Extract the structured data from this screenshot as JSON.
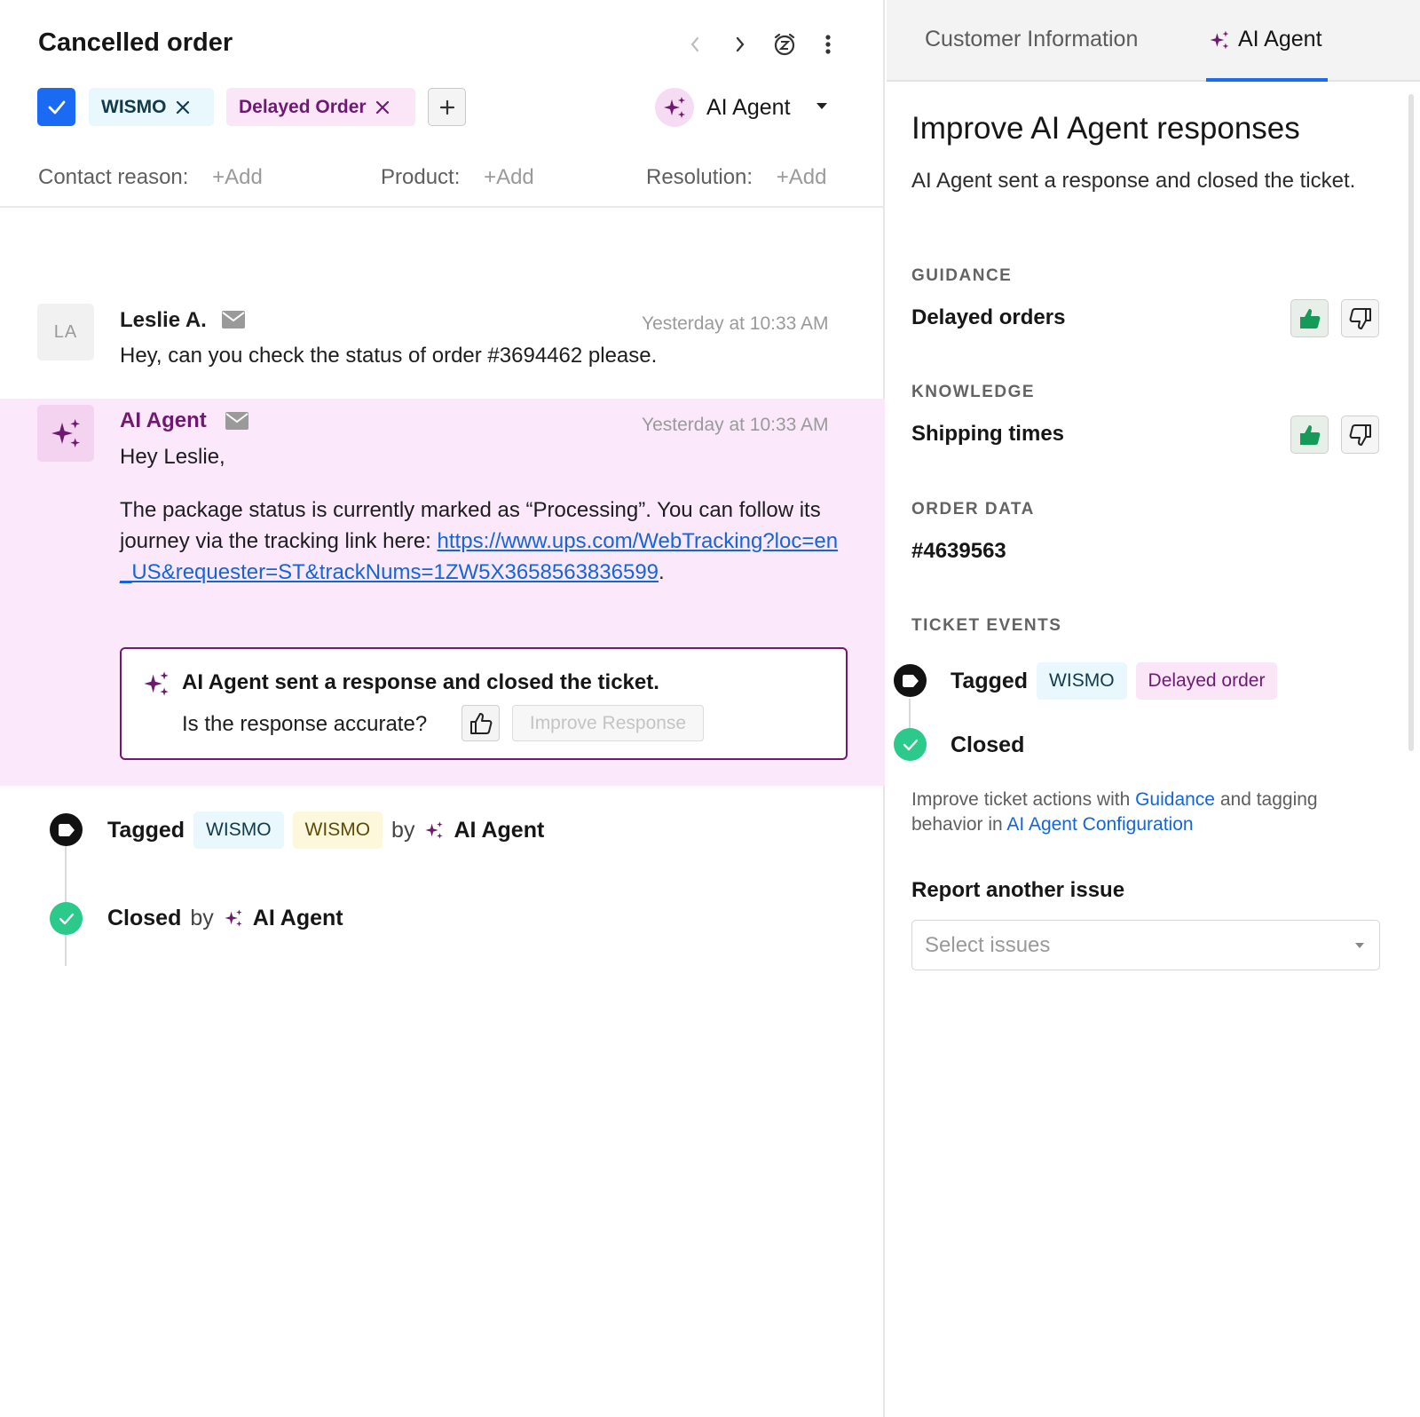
{
  "ticket": {
    "title": "Cancelled order",
    "tags": [
      "WISMO",
      "Delayed Order"
    ],
    "assignee": "AI Agent"
  },
  "fields": {
    "contact_reason_label": "Contact reason:",
    "product_label": "Product:",
    "resolution_label": "Resolution:",
    "add_label": "+Add"
  },
  "messages": [
    {
      "initials": "LA",
      "author": "Leslie A.",
      "time": "Yesterday at 10:33 AM",
      "text": "Hey, can you check the status of order #3694462 please."
    },
    {
      "author": "AI Agent",
      "time": "Yesterday at 10:33 AM",
      "greeting": "Hey Leslie,",
      "text": "The package status is currently marked as “Processing”. You can follow its journey via the tracking link here:",
      "link": "https://www.ups.com/WebTracking?loc=en_US&requester=ST&trackNums=1ZW5X3658563836599",
      "link_suffix": "."
    }
  ],
  "closed_card": {
    "title": "AI Agent sent a response and closed the ticket.",
    "question": "Is the response accurate?",
    "improve_label": "Improve Response"
  },
  "timeline": {
    "tagged_label": "Tagged",
    "tag1": "WISMO",
    "tag2": "WISMO",
    "by_label": "by",
    "agent": "AI Agent",
    "closed_label": "Closed"
  },
  "right_panel": {
    "tabs": [
      "Customer Information",
      "AI Agent"
    ],
    "title": "Improve AI Agent responses",
    "subtitle": "AI Agent sent a response and closed the ticket.",
    "guidance_label": "GUIDANCE",
    "guidance_value": "Delayed orders",
    "knowledge_label": "KNOWLEDGE",
    "knowledge_value": "Shipping times",
    "order_label": "ORDER DATA",
    "order_value": "#4639563",
    "events_label": "TICKET EVENTS",
    "events_tagged": "Tagged",
    "events_tag1": "WISMO",
    "events_tag2": "Delayed order",
    "events_closed": "Closed",
    "helper_pre": "Improve ticket actions with ",
    "helper_link1": "Guidance",
    "helper_mid": " and tagging behavior in ",
    "helper_link2": "AI Agent Configuration",
    "report_title": "Report another issue",
    "select_placeholder": "Select issues"
  },
  "icons": {
    "sparkle": "sparkle-icon",
    "mail": "mail-icon",
    "snooze": "snooze-icon",
    "more": "more-vertical-icon",
    "tag": "tag-icon",
    "check": "check-icon"
  },
  "colors": {
    "accent": "#1a6af4",
    "agent_purple": "#701a6f",
    "highlight_bg": "#fbe8fb",
    "success": "#2bc98a",
    "link": "#1565d8"
  }
}
